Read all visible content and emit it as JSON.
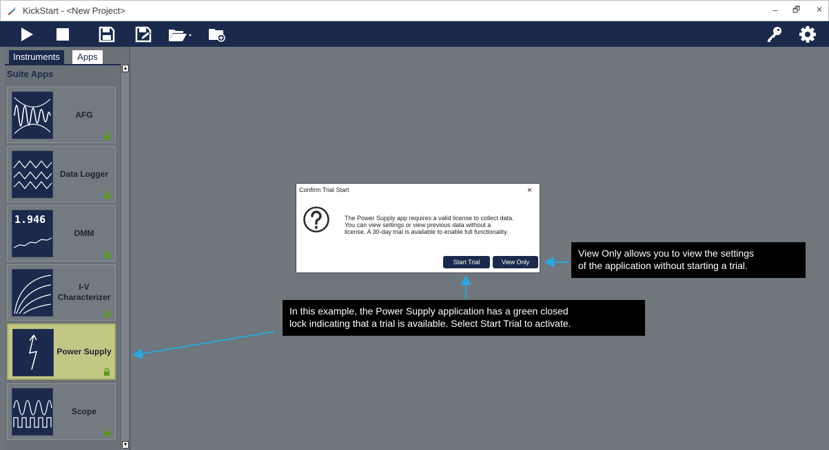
{
  "window": {
    "title": "KickStart - <New Project>",
    "controls": [
      "–",
      "🗗",
      "✕"
    ]
  },
  "toolbar": {
    "left_icons": [
      "play-icon",
      "stop-icon",
      "save-icon",
      "save-as-icon",
      "open-folder-icon",
      "new-folder-icon"
    ],
    "right_icons": [
      "license-key-icon",
      "settings-gear-icon"
    ],
    "accent": "#1b2a4c"
  },
  "sidebar": {
    "tabs": [
      "Instruments",
      "Apps"
    ],
    "active_tab": "Apps",
    "section_label": "Suite Apps",
    "apps": [
      {
        "label": "AFG",
        "thumb": "waveform",
        "locked": true
      },
      {
        "label": "Data Logger",
        "thumb": "multi-wave",
        "locked": true
      },
      {
        "label": "DMM",
        "thumb": "reading",
        "thumb_text": "1.946",
        "locked": true
      },
      {
        "label": "I-V Characterizer",
        "thumb": "curves",
        "locked": true
      },
      {
        "label": "Power Supply",
        "thumb": "bolt",
        "locked": true,
        "selected": true
      },
      {
        "label": "Scope",
        "thumb": "sine-square",
        "locked": true
      }
    ],
    "lock_color": "#5a9a1a"
  },
  "dialog": {
    "title": "Confirm Trial Start",
    "close": "×",
    "message_lines": [
      "The Power Supply app requires a valid license to collect data.",
      "You can view settings or view previous data without a",
      "license.  A 30-day trial is available to enable full functionality."
    ],
    "buttons": {
      "start_trial": "Start Trial",
      "view_only": "View Only"
    }
  },
  "callouts": {
    "view_only": [
      "View Only allows you to view the settings",
      "of the application without starting a trial."
    ],
    "trial": [
      "In this example, the Power Supply application has a green closed",
      "lock indicating that a trial is available. Select Start Trial to activate."
    ],
    "arrow_color": "#29a8e0"
  }
}
